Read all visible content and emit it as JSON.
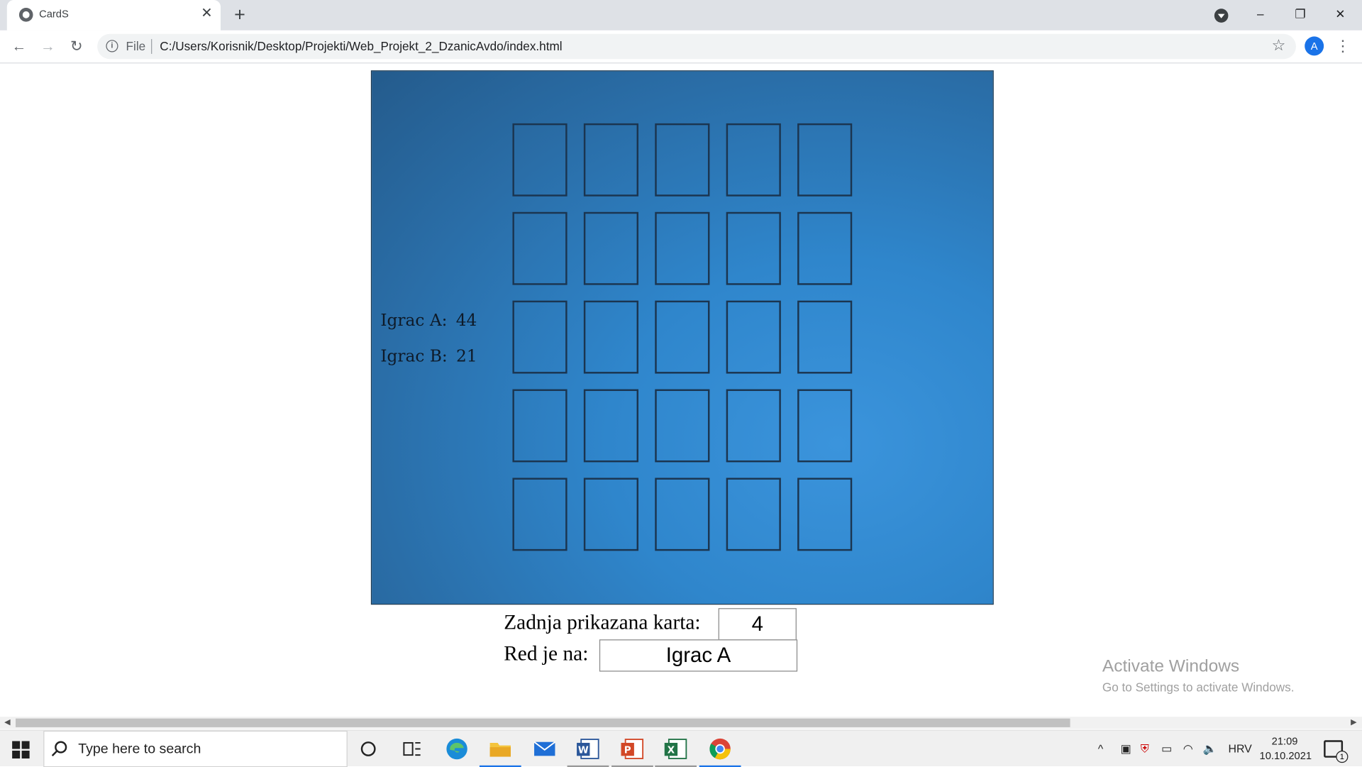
{
  "browser": {
    "tab_title": "CardS",
    "tab_close": "✕",
    "new_tab": "+",
    "file_label": "File",
    "url": "C:/Users/Korisnik/Desktop/Projekti/Web_Projekt_2_DzanicAvdo/index.html",
    "profile_initial": "A",
    "window_controls": {
      "minimize": "–",
      "restore": "❐",
      "close": "✕"
    }
  },
  "game": {
    "grid_rows": 5,
    "grid_cols": 5,
    "players": [
      {
        "label": "Igrac A:",
        "score": "44"
      },
      {
        "label": "Igrac B:",
        "score": "21"
      }
    ],
    "last_card_label": "Zadnja prikazana karta:",
    "last_card_value": "4",
    "turn_label": "Red je na:",
    "turn_value": "Igrac A"
  },
  "watermark": {
    "title": "Activate Windows",
    "subtitle": "Go to Settings to activate Windows."
  },
  "taskbar": {
    "search_placeholder": "Type here to search",
    "language": "HRV",
    "time": "21:09",
    "date": "10.10.2021",
    "notification_count": "1"
  },
  "colors": {
    "board_dark": "#245b8c",
    "board_light": "#3b94dc",
    "card_border": "#1b3550",
    "accent": "#1a73e8"
  }
}
